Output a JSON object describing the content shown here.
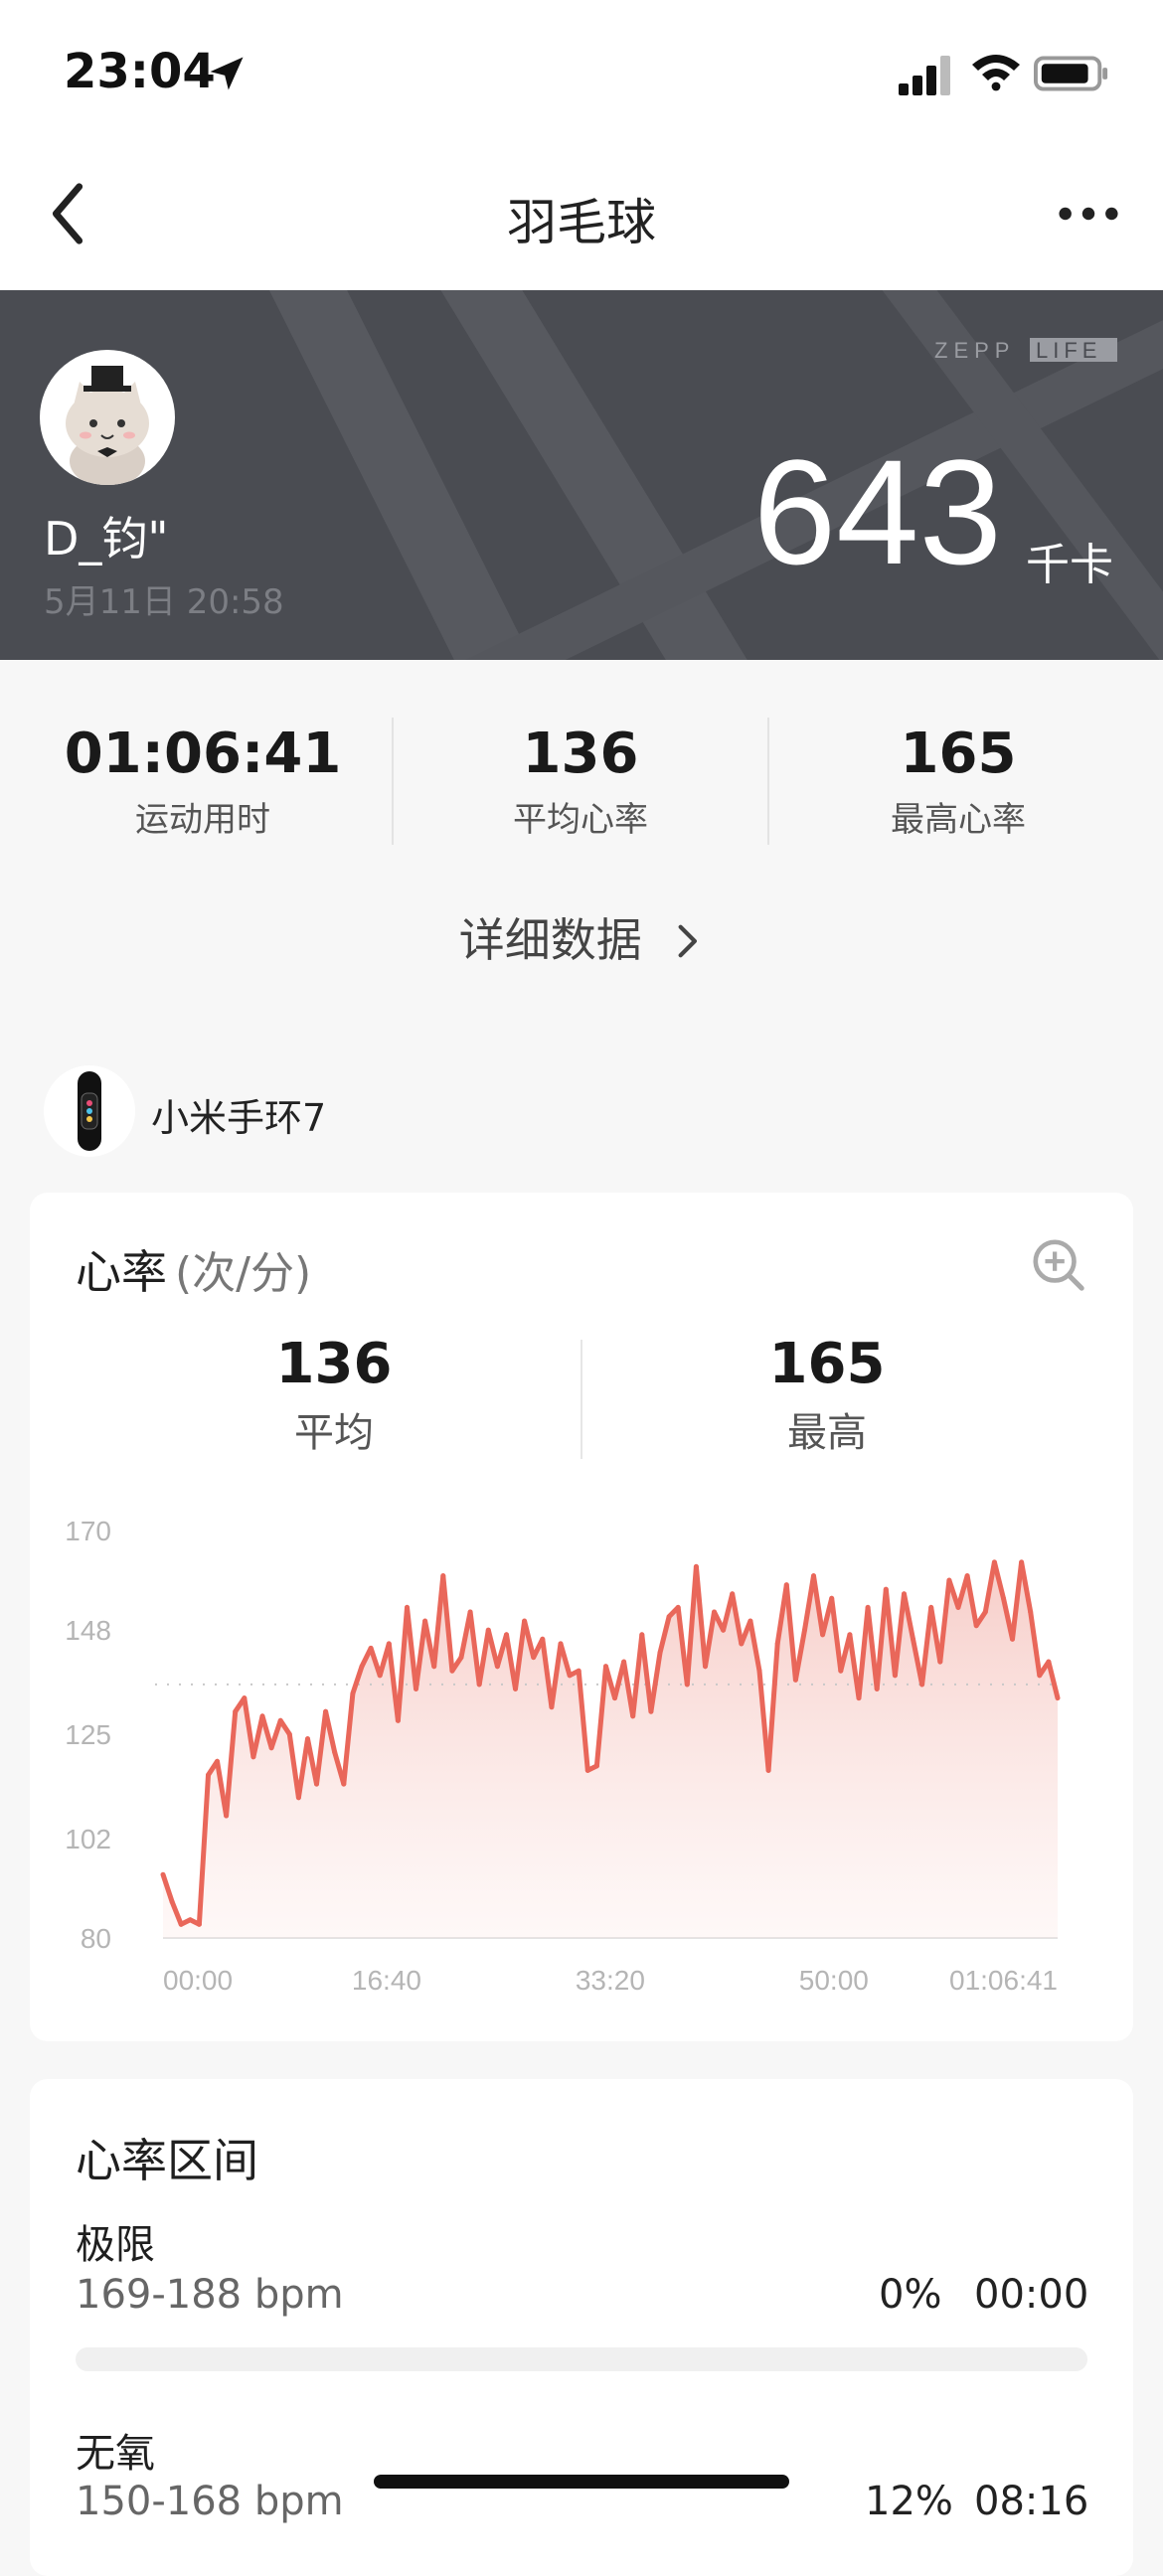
{
  "status_bar": {
    "time": "23:04"
  },
  "nav": {
    "title": "羽毛球"
  },
  "header": {
    "brand": "ZEPP LIFE",
    "user_name": "D_钧\"",
    "date": "5月11日 20:58",
    "calories": "643",
    "calories_unit": "千卡"
  },
  "summary": {
    "duration": {
      "value": "01:06:41",
      "label": "运动用时"
    },
    "avg_hr": {
      "value": "136",
      "label": "平均心率"
    },
    "max_hr": {
      "value": "165",
      "label": "最高心率"
    }
  },
  "detail_link": "详细数据",
  "device": {
    "name": "小米手环7"
  },
  "heart_rate": {
    "title": "心率",
    "unit": "(次/分)",
    "avg": {
      "value": "136",
      "label": "平均"
    },
    "max": {
      "value": "165",
      "label": "最高"
    }
  },
  "chart_data": {
    "type": "area",
    "title": "",
    "xlabel": "",
    "ylabel": "",
    "ylim": [
      80,
      170
    ],
    "yticks": [
      "170",
      "148",
      "125",
      "102",
      "80"
    ],
    "xticks": [
      "00:00",
      "16:40",
      "33:20",
      "50:00",
      "01:06:41"
    ],
    "x_seconds_range": [
      0,
      4001
    ],
    "average_line": 136,
    "color": "#e9675a",
    "series": [
      {
        "values": [
          94,
          88,
          83,
          84,
          83,
          116,
          119,
          107,
          130,
          133,
          120,
          129,
          122,
          128,
          125,
          111,
          124,
          114,
          130,
          121,
          114,
          134,
          140,
          144,
          138,
          145,
          128,
          153,
          135,
          150,
          140,
          160,
          139,
          142,
          152,
          136,
          148,
          140,
          147,
          135,
          150,
          142,
          146,
          131,
          145,
          138,
          139,
          117,
          118,
          140,
          133,
          141,
          129,
          147,
          130,
          143,
          151,
          153,
          136,
          162,
          140,
          152,
          148,
          156,
          145,
          150,
          139,
          117,
          145,
          158,
          137,
          148,
          160,
          147,
          155,
          139,
          147,
          133,
          153,
          135,
          157,
          138,
          156,
          146,
          136,
          153,
          141,
          159,
          153,
          160,
          149,
          152,
          163,
          155,
          146,
          163,
          152,
          138,
          141,
          133
        ]
      }
    ]
  },
  "zones": {
    "title": "心率区间",
    "items": [
      {
        "name": "极限",
        "range": "169-188 bpm",
        "percent": "0%",
        "duration": "00:00",
        "fill": 0.0
      },
      {
        "name": "无氧",
        "range": "150-168 bpm",
        "percent": "12%",
        "duration": "08:16",
        "fill": 0.12
      }
    ]
  },
  "colors": {
    "accent": "#e9675a",
    "header_bg": "#4a4c52"
  },
  "icons": {
    "back": "chevron-left-icon",
    "more": "more-dots-icon",
    "zoom": "zoom-in-icon",
    "detail": "chevron-right-icon"
  }
}
